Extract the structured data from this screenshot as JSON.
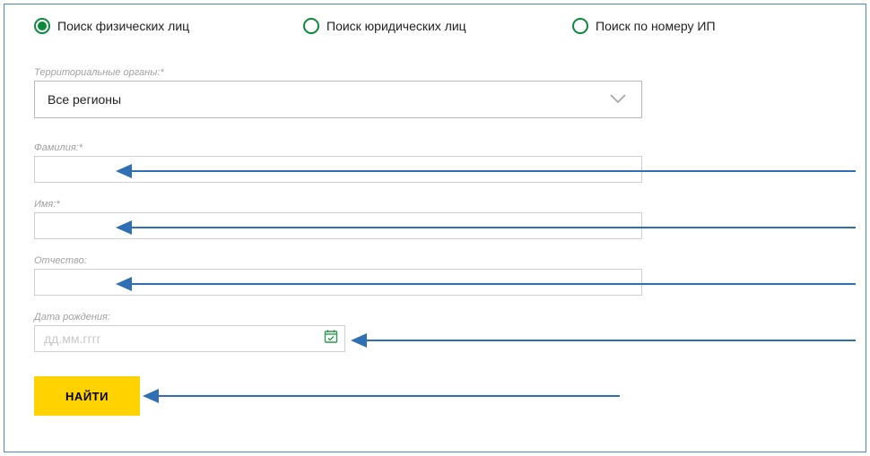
{
  "radios": {
    "opt1": "Поиск физических лиц",
    "opt2": "Поиск юридических лиц",
    "opt3": "Поиск по номеру ИП"
  },
  "territory": {
    "label": "Территориальные органы:*",
    "selected": "Все регионы"
  },
  "surname": {
    "label": "Фамилия:*",
    "value": ""
  },
  "name": {
    "label": "Имя:*",
    "value": ""
  },
  "patronym": {
    "label": "Отчество:",
    "value": ""
  },
  "dob": {
    "label": "Дата рождения:",
    "placeholder": "дд.мм.гггг",
    "value": ""
  },
  "search_label": "НАЙТИ",
  "colors": {
    "accent_green": "#0a8a3a",
    "button_yellow": "#ffd200",
    "arrow_blue": "#2f6fb3",
    "frame_blue": "#4a89c8"
  }
}
